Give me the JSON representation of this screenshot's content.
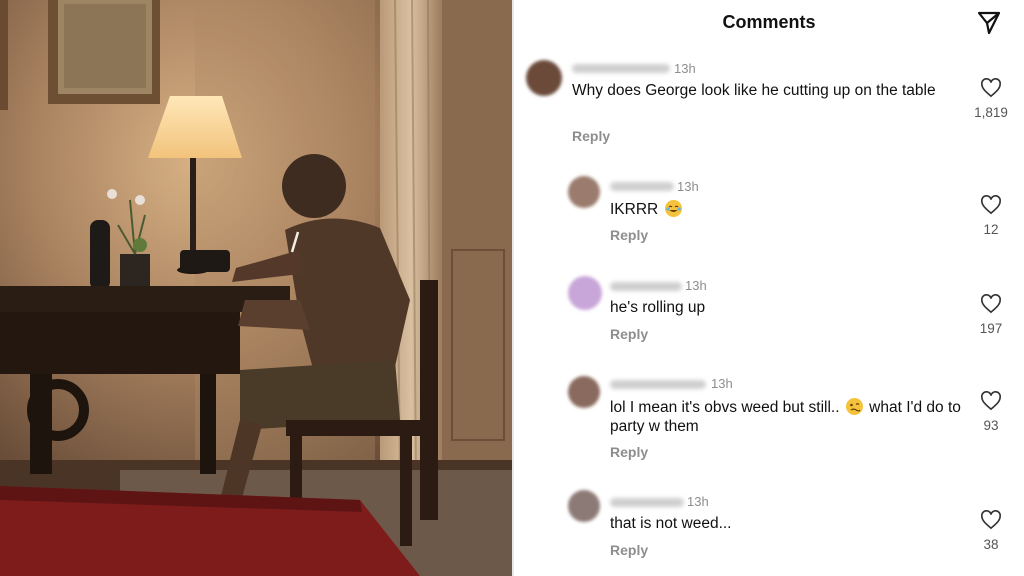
{
  "panel": {
    "title": "Comments",
    "share_icon": "paper-plane-icon"
  },
  "comments": [
    {
      "time": "13h",
      "text": "Why does George look like he cutting up on the table",
      "reply": "Reply",
      "likes": "1,819",
      "avatar_color": "#6b4a3a"
    },
    {
      "time": "13h",
      "text": "IKRRR",
      "emoji": "tears-of-joy-emoji",
      "reply": "Reply",
      "likes": "12",
      "avatar_color": "#9a7b6e"
    },
    {
      "time": "13h",
      "text": "he's rolling up",
      "reply": "Reply",
      "likes": "197",
      "avatar_color": "#c9a6d9"
    },
    {
      "time": "13h",
      "text_before": "lol I mean it's obvs weed but still..",
      "emoji": "woozy-face-emoji",
      "text_after": "what I'd do to party w them",
      "reply": "Reply",
      "likes": "93",
      "avatar_color": "#8a6a5e"
    },
    {
      "time": "13h",
      "text": "that is not weed...",
      "reply": "Reply",
      "likes": "38",
      "avatar_color": "#8c7a76"
    }
  ]
}
